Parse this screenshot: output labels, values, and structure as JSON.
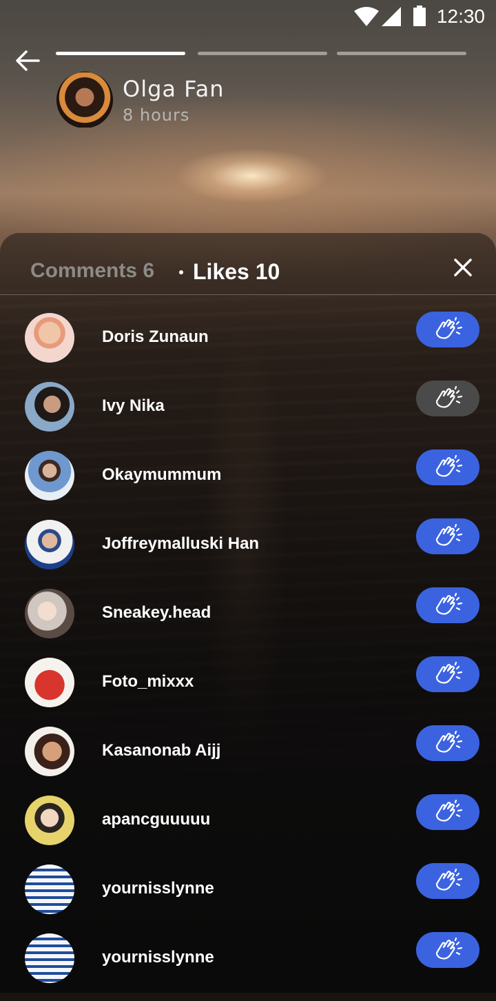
{
  "status_bar": {
    "time": "12:30"
  },
  "story": {
    "author_name": "Olga Fan",
    "time_ago": "8 hours"
  },
  "colors": {
    "accent_blue": "#3b63e0",
    "inactive_gray": "#4a4a4a"
  },
  "sheet": {
    "tab_comments": "Comments 6",
    "tab_likes": "Likes 10"
  },
  "likes": [
    {
      "name": "Doris Zunaun",
      "clapped": true
    },
    {
      "name": "Ivy Nika",
      "clapped": false
    },
    {
      "name": "Okaymummum",
      "clapped": true
    },
    {
      "name": "Joffreymalluski Han",
      "clapped": true
    },
    {
      "name": "Sneakey.head",
      "clapped": true
    },
    {
      "name": "Foto_mixxx",
      "clapped": true
    },
    {
      "name": "Kasanonab Aijj",
      "clapped": true
    },
    {
      "name": "apancguuuuu",
      "clapped": true
    },
    {
      "name": "yournisslynne",
      "clapped": true
    },
    {
      "name": "yournisslynne",
      "clapped": true
    }
  ]
}
